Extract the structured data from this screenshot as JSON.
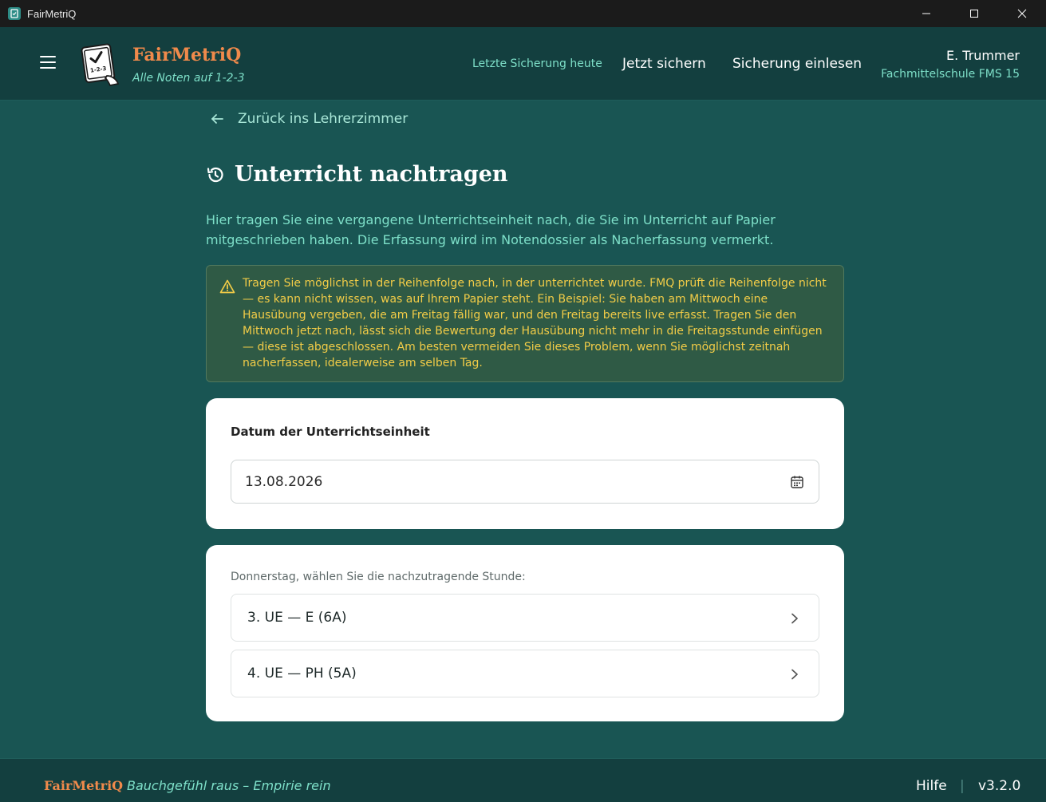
{
  "window": {
    "title": "FairMetriQ"
  },
  "header": {
    "brand_name": "FairMetriQ",
    "brand_tagline": "Alle Noten auf 1-2-3",
    "logo_text": "1-2-3",
    "last_backup": "Letzte Sicherung heute",
    "backup_now": "Jetzt sichern",
    "restore_backup": "Sicherung einlesen",
    "user_name": "E. Trummer",
    "user_school": "Fachmittelschule FMS 15"
  },
  "main": {
    "back_link": "Zurück ins Lehrerzimmer",
    "title": "Unterricht nachtragen",
    "intro": "Hier tragen Sie eine vergangene Unterrichtseinheit nach, die Sie im Unterricht auf Papier mitgeschrieben haben. Die Erfassung wird im Notendossier als Nacherfassung vermerkt.",
    "warning": "Tragen Sie möglichst in der Reihenfolge nach, in der unterrichtet wurde. FMQ prüft die Reihenfolge nicht — es kann nicht wissen, was auf Ihrem Papier steht. Ein Beispiel: Sie haben am Mittwoch eine Hausübung vergeben, die am Freitag fällig war, und den Freitag bereits live erfasst. Tragen Sie den Mittwoch jetzt nach, lässt sich die Bewertung der Hausübung nicht mehr in die Freitagsstunde einfügen — diese ist abgeschlossen. Am besten vermeiden Sie dieses Problem, wenn Sie möglichst zeitnah nacherfassen, idealerweise am selben Tag.",
    "date_label": "Datum der Unterrichtseinheit",
    "date_value": "13.08.2026",
    "lesson_prompt": "Donnerstag, wählen Sie die nachzutragende Stunde:",
    "lessons": [
      {
        "label": "3. UE — E (6A)"
      },
      {
        "label": "4. UE — PH (5A)"
      }
    ]
  },
  "footer": {
    "brand_name": "FairMetriQ",
    "tagline": "Bauchgefühl raus – Empirie rein",
    "help": "Hilfe",
    "separator": "|",
    "version": "v3.2.0"
  },
  "colors": {
    "background": "#195553",
    "header_bg": "#133f3f",
    "accent_orange": "#f08a4b",
    "accent_mint": "#7ee0c9",
    "warning_text": "#f2cc47",
    "warning_bg": "#2f5a45"
  },
  "icons": {
    "app": "tablet-check-icon",
    "menu": "hamburger-icon",
    "back": "arrow-left-icon",
    "title": "history-icon",
    "warning": "warning-triangle-icon",
    "date": "calendar-icon",
    "lesson": "chevron-right-icon"
  }
}
